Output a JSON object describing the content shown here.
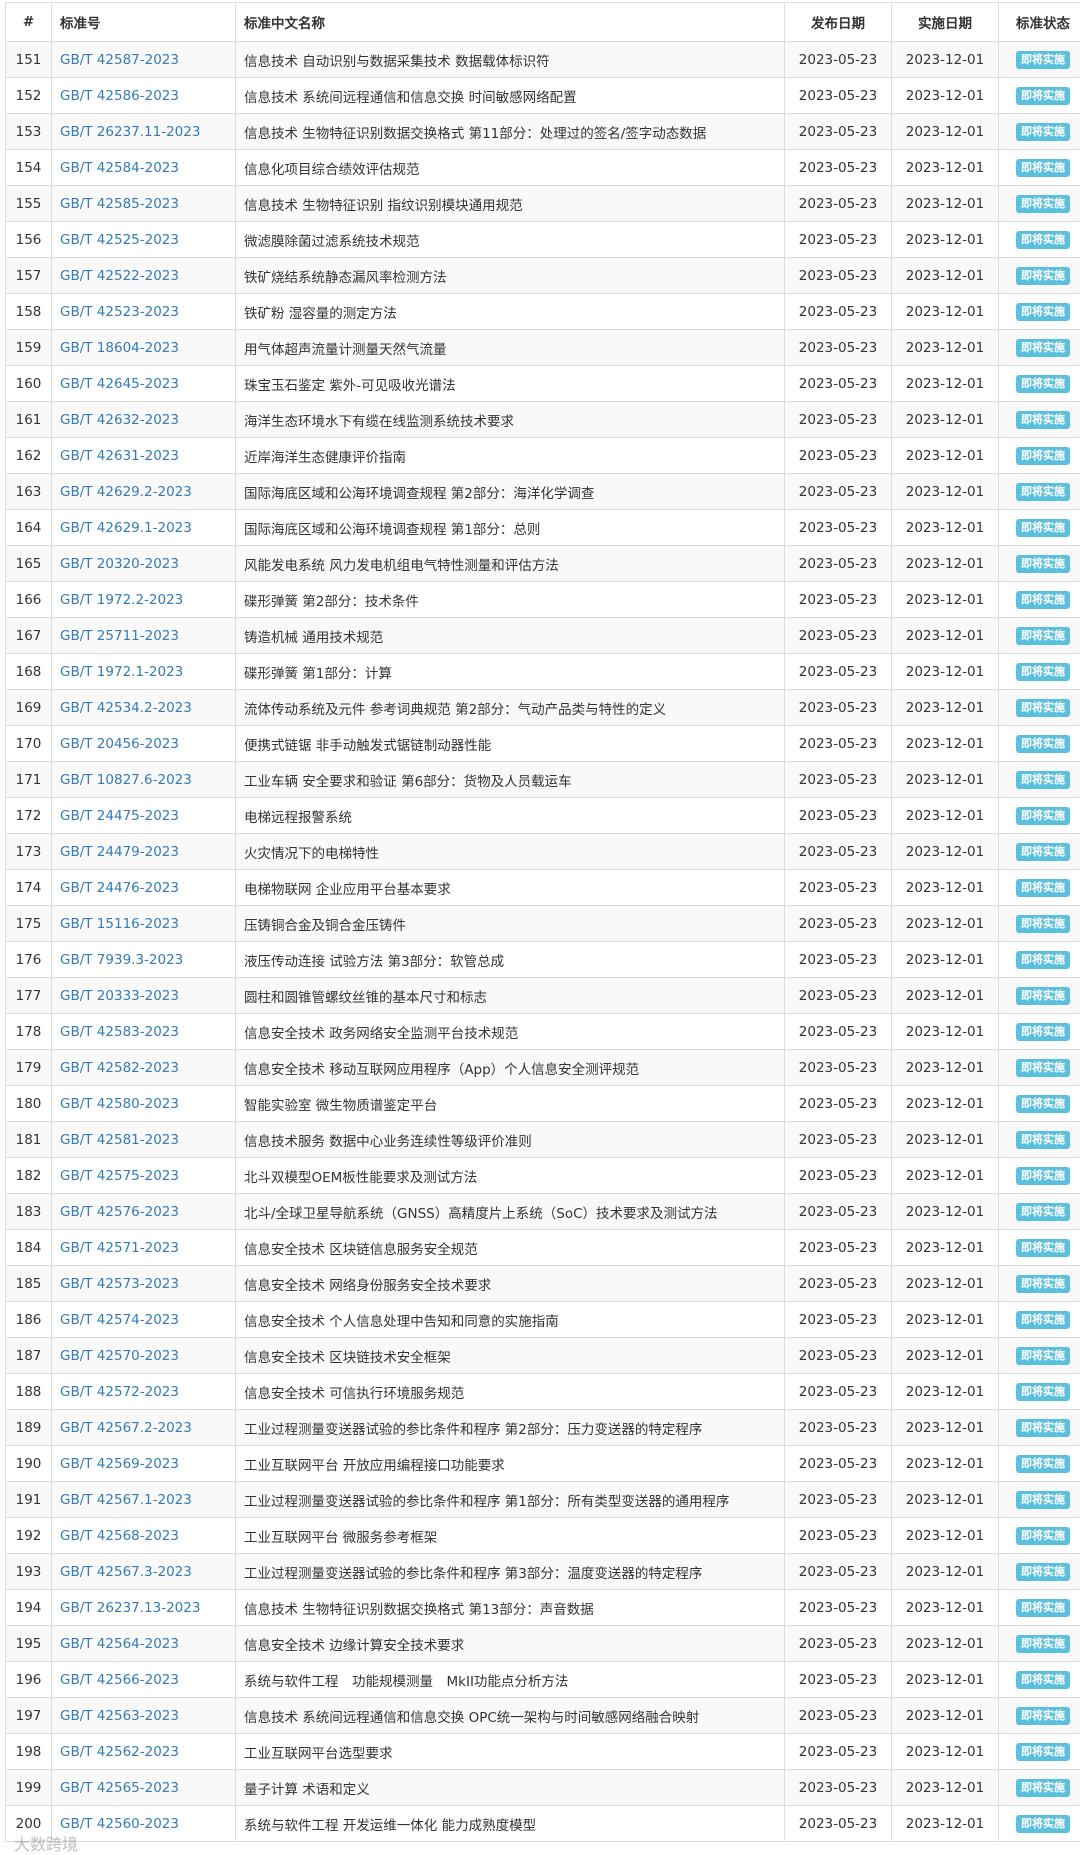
{
  "table": {
    "headers": {
      "num": "#",
      "code": "标准号",
      "name": "标准中文名称",
      "publish": "发布日期",
      "implement": "实施日期",
      "status": "标准状态"
    },
    "rows": [
      {
        "num": "151",
        "code": "GB/T 42587-2023",
        "name": "信息技术 自动识别与数据采集技术 数据载体标识符",
        "publish": "2023-05-23",
        "implement": "2023-12-01",
        "status": "即将实施"
      },
      {
        "num": "152",
        "code": "GB/T 42586-2023",
        "name": "信息技术 系统间远程通信和信息交换 时间敏感网络配置",
        "publish": "2023-05-23",
        "implement": "2023-12-01",
        "status": "即将实施"
      },
      {
        "num": "153",
        "code": "GB/T 26237.11-2023",
        "name": "信息技术 生物特征识别数据交换格式 第11部分：处理过的签名/签字动态数据",
        "publish": "2023-05-23",
        "implement": "2023-12-01",
        "status": "即将实施"
      },
      {
        "num": "154",
        "code": "GB/T 42584-2023",
        "name": "信息化项目综合绩效评估规范",
        "publish": "2023-05-23",
        "implement": "2023-12-01",
        "status": "即将实施"
      },
      {
        "num": "155",
        "code": "GB/T 42585-2023",
        "name": "信息技术 生物特征识别 指纹识别模块通用规范",
        "publish": "2023-05-23",
        "implement": "2023-12-01",
        "status": "即将实施"
      },
      {
        "num": "156",
        "code": "GB/T 42525-2023",
        "name": "微滤膜除菌过滤系统技术规范",
        "publish": "2023-05-23",
        "implement": "2023-12-01",
        "status": "即将实施"
      },
      {
        "num": "157",
        "code": "GB/T 42522-2023",
        "name": "铁矿烧结系统静态漏风率检测方法",
        "publish": "2023-05-23",
        "implement": "2023-12-01",
        "status": "即将实施"
      },
      {
        "num": "158",
        "code": "GB/T 42523-2023",
        "name": "铁矿粉 湿容量的测定方法",
        "publish": "2023-05-23",
        "implement": "2023-12-01",
        "status": "即将实施"
      },
      {
        "num": "159",
        "code": "GB/T 18604-2023",
        "name": "用气体超声流量计测量天然气流量",
        "publish": "2023-05-23",
        "implement": "2023-12-01",
        "status": "即将实施"
      },
      {
        "num": "160",
        "code": "GB/T 42645-2023",
        "name": "珠宝玉石鉴定 紫外-可见吸收光谱法",
        "publish": "2023-05-23",
        "implement": "2023-12-01",
        "status": "即将实施"
      },
      {
        "num": "161",
        "code": "GB/T 42632-2023",
        "name": "海洋生态环境水下有缆在线监测系统技术要求",
        "publish": "2023-05-23",
        "implement": "2023-12-01",
        "status": "即将实施"
      },
      {
        "num": "162",
        "code": "GB/T 42631-2023",
        "name": "近岸海洋生态健康评价指南",
        "publish": "2023-05-23",
        "implement": "2023-12-01",
        "status": "即将实施"
      },
      {
        "num": "163",
        "code": "GB/T 42629.2-2023",
        "name": "国际海底区域和公海环境调查规程 第2部分：海洋化学调查",
        "publish": "2023-05-23",
        "implement": "2023-12-01",
        "status": "即将实施"
      },
      {
        "num": "164",
        "code": "GB/T 42629.1-2023",
        "name": "国际海底区域和公海环境调查规程 第1部分：总则",
        "publish": "2023-05-23",
        "implement": "2023-12-01",
        "status": "即将实施"
      },
      {
        "num": "165",
        "code": "GB/T 20320-2023",
        "name": "风能发电系统 风力发电机组电气特性测量和评估方法",
        "publish": "2023-05-23",
        "implement": "2023-12-01",
        "status": "即将实施"
      },
      {
        "num": "166",
        "code": "GB/T 1972.2-2023",
        "name": "碟形弹簧 第2部分：技术条件",
        "publish": "2023-05-23",
        "implement": "2023-12-01",
        "status": "即将实施"
      },
      {
        "num": "167",
        "code": "GB/T 25711-2023",
        "name": "铸造机械 通用技术规范",
        "publish": "2023-05-23",
        "implement": "2023-12-01",
        "status": "即将实施"
      },
      {
        "num": "168",
        "code": "GB/T 1972.1-2023",
        "name": "碟形弹簧 第1部分：计算",
        "publish": "2023-05-23",
        "implement": "2023-12-01",
        "status": "即将实施"
      },
      {
        "num": "169",
        "code": "GB/T 42534.2-2023",
        "name": "流体传动系统及元件 参考词典规范 第2部分：气动产品类与特性的定义",
        "publish": "2023-05-23",
        "implement": "2023-12-01",
        "status": "即将实施"
      },
      {
        "num": "170",
        "code": "GB/T 20456-2023",
        "name": "便携式链锯 非手动触发式锯链制动器性能",
        "publish": "2023-05-23",
        "implement": "2023-12-01",
        "status": "即将实施"
      },
      {
        "num": "171",
        "code": "GB/T 10827.6-2023",
        "name": "工业车辆 安全要求和验证 第6部分：货物及人员载运车",
        "publish": "2023-05-23",
        "implement": "2023-12-01",
        "status": "即将实施"
      },
      {
        "num": "172",
        "code": "GB/T 24475-2023",
        "name": "电梯远程报警系统",
        "publish": "2023-05-23",
        "implement": "2023-12-01",
        "status": "即将实施"
      },
      {
        "num": "173",
        "code": "GB/T 24479-2023",
        "name": "火灾情况下的电梯特性",
        "publish": "2023-05-23",
        "implement": "2023-12-01",
        "status": "即将实施"
      },
      {
        "num": "174",
        "code": "GB/T 24476-2023",
        "name": "电梯物联网 企业应用平台基本要求",
        "publish": "2023-05-23",
        "implement": "2023-12-01",
        "status": "即将实施"
      },
      {
        "num": "175",
        "code": "GB/T 15116-2023",
        "name": "压铸铜合金及铜合金压铸件",
        "publish": "2023-05-23",
        "implement": "2023-12-01",
        "status": "即将实施"
      },
      {
        "num": "176",
        "code": "GB/T 7939.3-2023",
        "name": "液压传动连接 试验方法 第3部分：软管总成",
        "publish": "2023-05-23",
        "implement": "2023-12-01",
        "status": "即将实施"
      },
      {
        "num": "177",
        "code": "GB/T 20333-2023",
        "name": "圆柱和圆锥管螺纹丝锥的基本尺寸和标志",
        "publish": "2023-05-23",
        "implement": "2023-12-01",
        "status": "即将实施"
      },
      {
        "num": "178",
        "code": "GB/T 42583-2023",
        "name": "信息安全技术 政务网络安全监测平台技术规范",
        "publish": "2023-05-23",
        "implement": "2023-12-01",
        "status": "即将实施"
      },
      {
        "num": "179",
        "code": "GB/T 42582-2023",
        "name": "信息安全技术 移动互联网应用程序（App）个人信息安全测评规范",
        "publish": "2023-05-23",
        "implement": "2023-12-01",
        "status": "即将实施"
      },
      {
        "num": "180",
        "code": "GB/T 42580-2023",
        "name": "智能实验室 微生物质谱鉴定平台",
        "publish": "2023-05-23",
        "implement": "2023-12-01",
        "status": "即将实施"
      },
      {
        "num": "181",
        "code": "GB/T 42581-2023",
        "name": "信息技术服务 数据中心业务连续性等级评价准则",
        "publish": "2023-05-23",
        "implement": "2023-12-01",
        "status": "即将实施"
      },
      {
        "num": "182",
        "code": "GB/T 42575-2023",
        "name": "北斗双模型OEM板性能要求及测试方法",
        "publish": "2023-05-23",
        "implement": "2023-12-01",
        "status": "即将实施"
      },
      {
        "num": "183",
        "code": "GB/T 42576-2023",
        "name": "北斗/全球卫星导航系统（GNSS）高精度片上系统（SoC）技术要求及测试方法",
        "publish": "2023-05-23",
        "implement": "2023-12-01",
        "status": "即将实施"
      },
      {
        "num": "184",
        "code": "GB/T 42571-2023",
        "name": "信息安全技术 区块链信息服务安全规范",
        "publish": "2023-05-23",
        "implement": "2023-12-01",
        "status": "即将实施"
      },
      {
        "num": "185",
        "code": "GB/T 42573-2023",
        "name": "信息安全技术 网络身份服务安全技术要求",
        "publish": "2023-05-23",
        "implement": "2023-12-01",
        "status": "即将实施"
      },
      {
        "num": "186",
        "code": "GB/T 42574-2023",
        "name": "信息安全技术 个人信息处理中告知和同意的实施指南",
        "publish": "2023-05-23",
        "implement": "2023-12-01",
        "status": "即将实施"
      },
      {
        "num": "187",
        "code": "GB/T 42570-2023",
        "name": "信息安全技术 区块链技术安全框架",
        "publish": "2023-05-23",
        "implement": "2023-12-01",
        "status": "即将实施"
      },
      {
        "num": "188",
        "code": "GB/T 42572-2023",
        "name": "信息安全技术 可信执行环境服务规范",
        "publish": "2023-05-23",
        "implement": "2023-12-01",
        "status": "即将实施"
      },
      {
        "num": "189",
        "code": "GB/T 42567.2-2023",
        "name": "工业过程测量变送器试验的参比条件和程序 第2部分：压力变送器的特定程序",
        "publish": "2023-05-23",
        "implement": "2023-12-01",
        "status": "即将实施"
      },
      {
        "num": "190",
        "code": "GB/T 42569-2023",
        "name": "工业互联网平台 开放应用编程接口功能要求",
        "publish": "2023-05-23",
        "implement": "2023-12-01",
        "status": "即将实施"
      },
      {
        "num": "191",
        "code": "GB/T 42567.1-2023",
        "name": "工业过程测量变送器试验的参比条件和程序 第1部分：所有类型变送器的通用程序",
        "publish": "2023-05-23",
        "implement": "2023-12-01",
        "status": "即将实施"
      },
      {
        "num": "192",
        "code": "GB/T 42568-2023",
        "name": "工业互联网平台 微服务参考框架",
        "publish": "2023-05-23",
        "implement": "2023-12-01",
        "status": "即将实施"
      },
      {
        "num": "193",
        "code": "GB/T 42567.3-2023",
        "name": "工业过程测量变送器试验的参比条件和程序 第3部分：温度变送器的特定程序",
        "publish": "2023-05-23",
        "implement": "2023-12-01",
        "status": "即将实施"
      },
      {
        "num": "194",
        "code": "GB/T 26237.13-2023",
        "name": "信息技术 生物特征识别数据交换格式 第13部分：声音数据",
        "publish": "2023-05-23",
        "implement": "2023-12-01",
        "status": "即将实施"
      },
      {
        "num": "195",
        "code": "GB/T 42564-2023",
        "name": "信息安全技术 边缘计算安全技术要求",
        "publish": "2023-05-23",
        "implement": "2023-12-01",
        "status": "即将实施"
      },
      {
        "num": "196",
        "code": "GB/T 42566-2023",
        "name": "系统与软件工程　功能规模测量　MkII功能点分析方法",
        "publish": "2023-05-23",
        "implement": "2023-12-01",
        "status": "即将实施"
      },
      {
        "num": "197",
        "code": "GB/T 42563-2023",
        "name": "信息技术 系统间远程通信和信息交换 OPC统一架构与时间敏感网络融合映射",
        "publish": "2023-05-23",
        "implement": "2023-12-01",
        "status": "即将实施"
      },
      {
        "num": "198",
        "code": "GB/T 42562-2023",
        "name": "工业互联网平台选型要求",
        "publish": "2023-05-23",
        "implement": "2023-12-01",
        "status": "即将实施"
      },
      {
        "num": "199",
        "code": "GB/T 42565-2023",
        "name": "量子计算 术语和定义",
        "publish": "2023-05-23",
        "implement": "2023-12-01",
        "status": "即将实施"
      },
      {
        "num": "200",
        "code": "GB/T 42560-2023",
        "name": "系统与软件工程 开发运维一体化 能力成熟度模型",
        "publish": "2023-05-23",
        "implement": "2023-12-01",
        "status": "即将实施"
      }
    ]
  },
  "watermark": "大数跨境"
}
